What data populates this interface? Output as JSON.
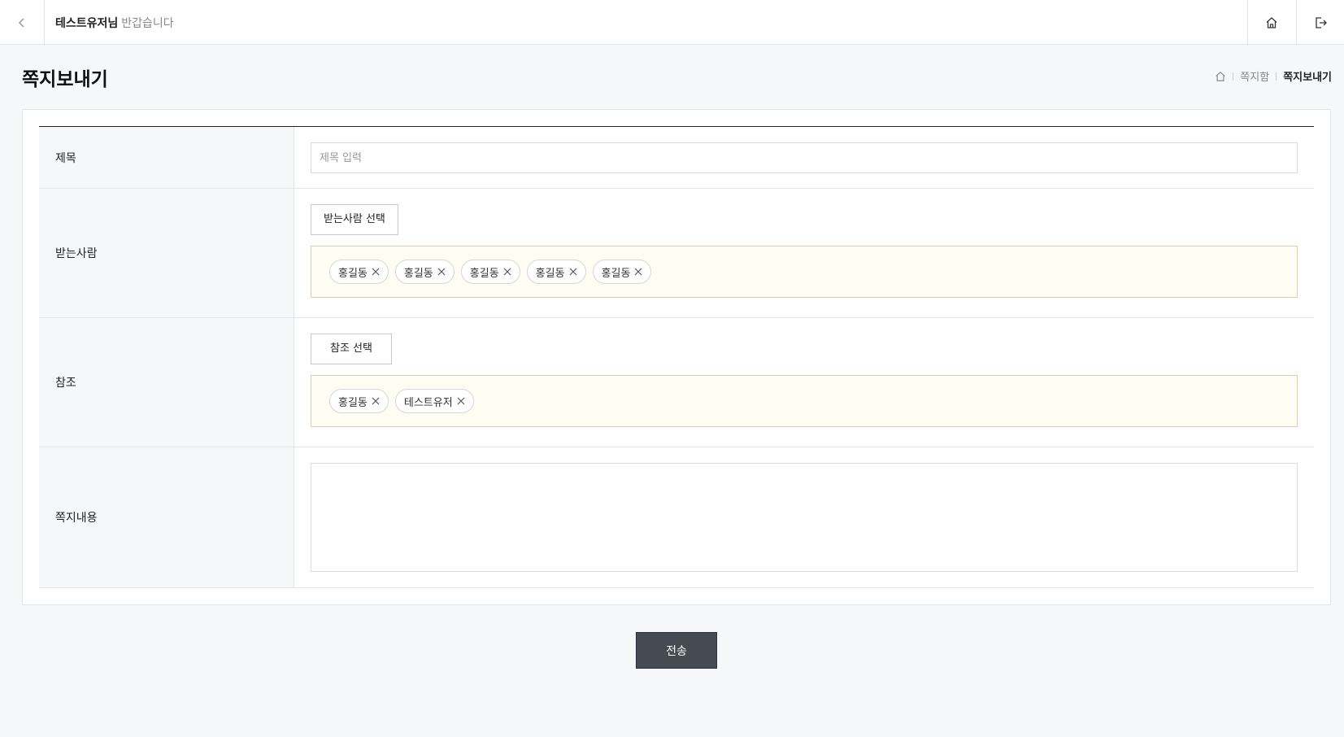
{
  "header": {
    "user_name": "테스트유저님",
    "greeting": "반갑습니다",
    "icons": {
      "back": "chevron-left-icon",
      "home": "home-icon",
      "logout": "logout-icon"
    }
  },
  "page": {
    "title": "쪽지보내기",
    "breadcrumb": {
      "level1": "쪽지함",
      "current": "쪽지보내기"
    }
  },
  "form": {
    "subject": {
      "label": "제목",
      "placeholder": "제목 입력",
      "value": ""
    },
    "recipients": {
      "label": "받는사람",
      "button_label": "받는사람 선택",
      "chips": [
        "홍길동",
        "홍길동",
        "홍길동",
        "홍길동",
        "홍길동"
      ]
    },
    "cc": {
      "label": "참조",
      "button_label": "참조 선택",
      "chips": [
        "홍길동",
        "테스트유저"
      ]
    },
    "content": {
      "label": "쪽지내용",
      "value": ""
    }
  },
  "actions": {
    "submit_label": "전송"
  },
  "colors": {
    "accent_dark": "#454a53",
    "chip_box_bg": "#fffcf3"
  }
}
